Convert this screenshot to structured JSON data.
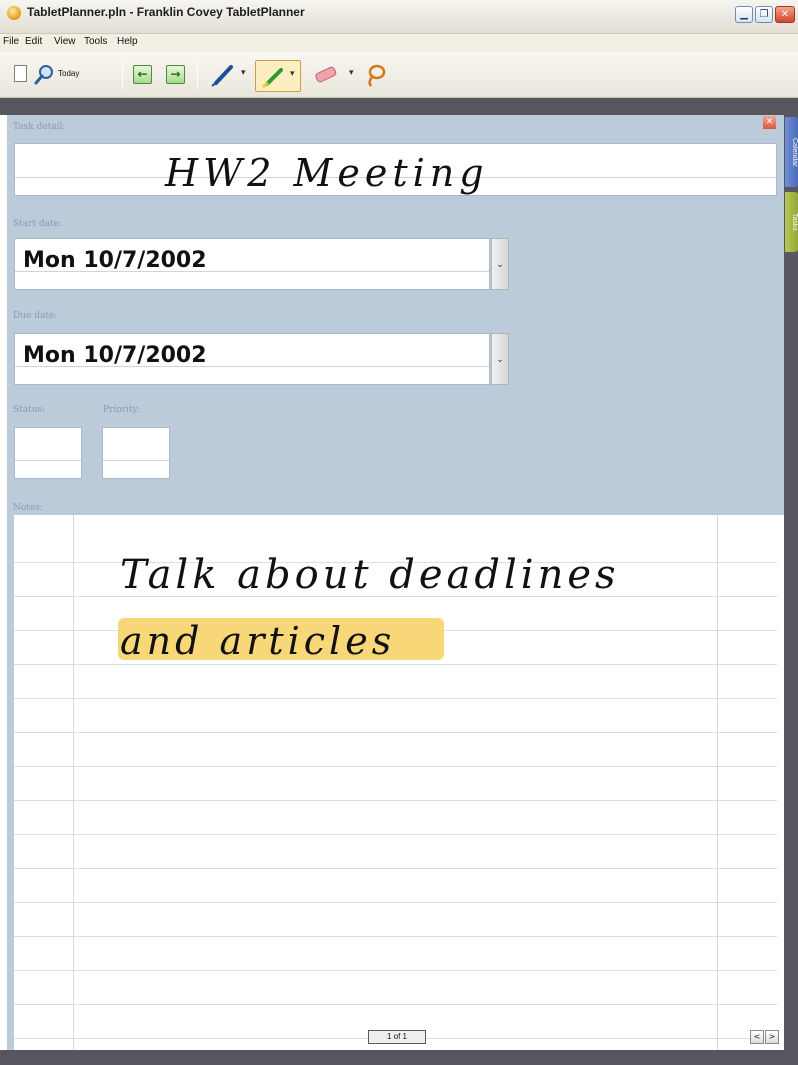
{
  "window": {
    "title": "TabletPlanner.pln - Franklin Covey TabletPlanner",
    "min_symbol": "▁",
    "max_symbol": "❐",
    "close_symbol": "✕"
  },
  "menu": [
    "File",
    "Edit",
    "View",
    "Tools",
    "Help"
  ],
  "toolbar": {
    "today_label": "Today",
    "prev_symbol": "←",
    "next_symbol": "→",
    "dropdown_symbol": "▾",
    "icons": [
      "new-page-icon",
      "find-icon",
      "prev-icon",
      "next-icon",
      "pen-icon",
      "highlighter-icon",
      "eraser-icon",
      "lasso-icon"
    ]
  },
  "side_tabs": {
    "calendar": "Calendar",
    "tasks": "Tasks"
  },
  "form": {
    "close_symbol": "✕",
    "task_detail_label": "Task detail:",
    "task_detail_ink": "HW2 Meeting",
    "start_date_label": "Start date:",
    "start_date_value": "Mon 10/7/2002",
    "due_date_label": "Due date:",
    "due_date_value": "Mon 10/7/2002",
    "status_label": "Status:",
    "priority_label": "Priority:",
    "notes_label": "Notes:",
    "notes_ink": [
      "Talk about deadlines",
      "and articles"
    ],
    "dropdown_symbol": "⌄"
  },
  "pager": {
    "indicator": "1 of 1",
    "prev_symbol": "<",
    "next_symbol": ">"
  },
  "colors": {
    "panel": "#bccbda",
    "ink": "#111111",
    "highlight": "#f7d36a"
  }
}
